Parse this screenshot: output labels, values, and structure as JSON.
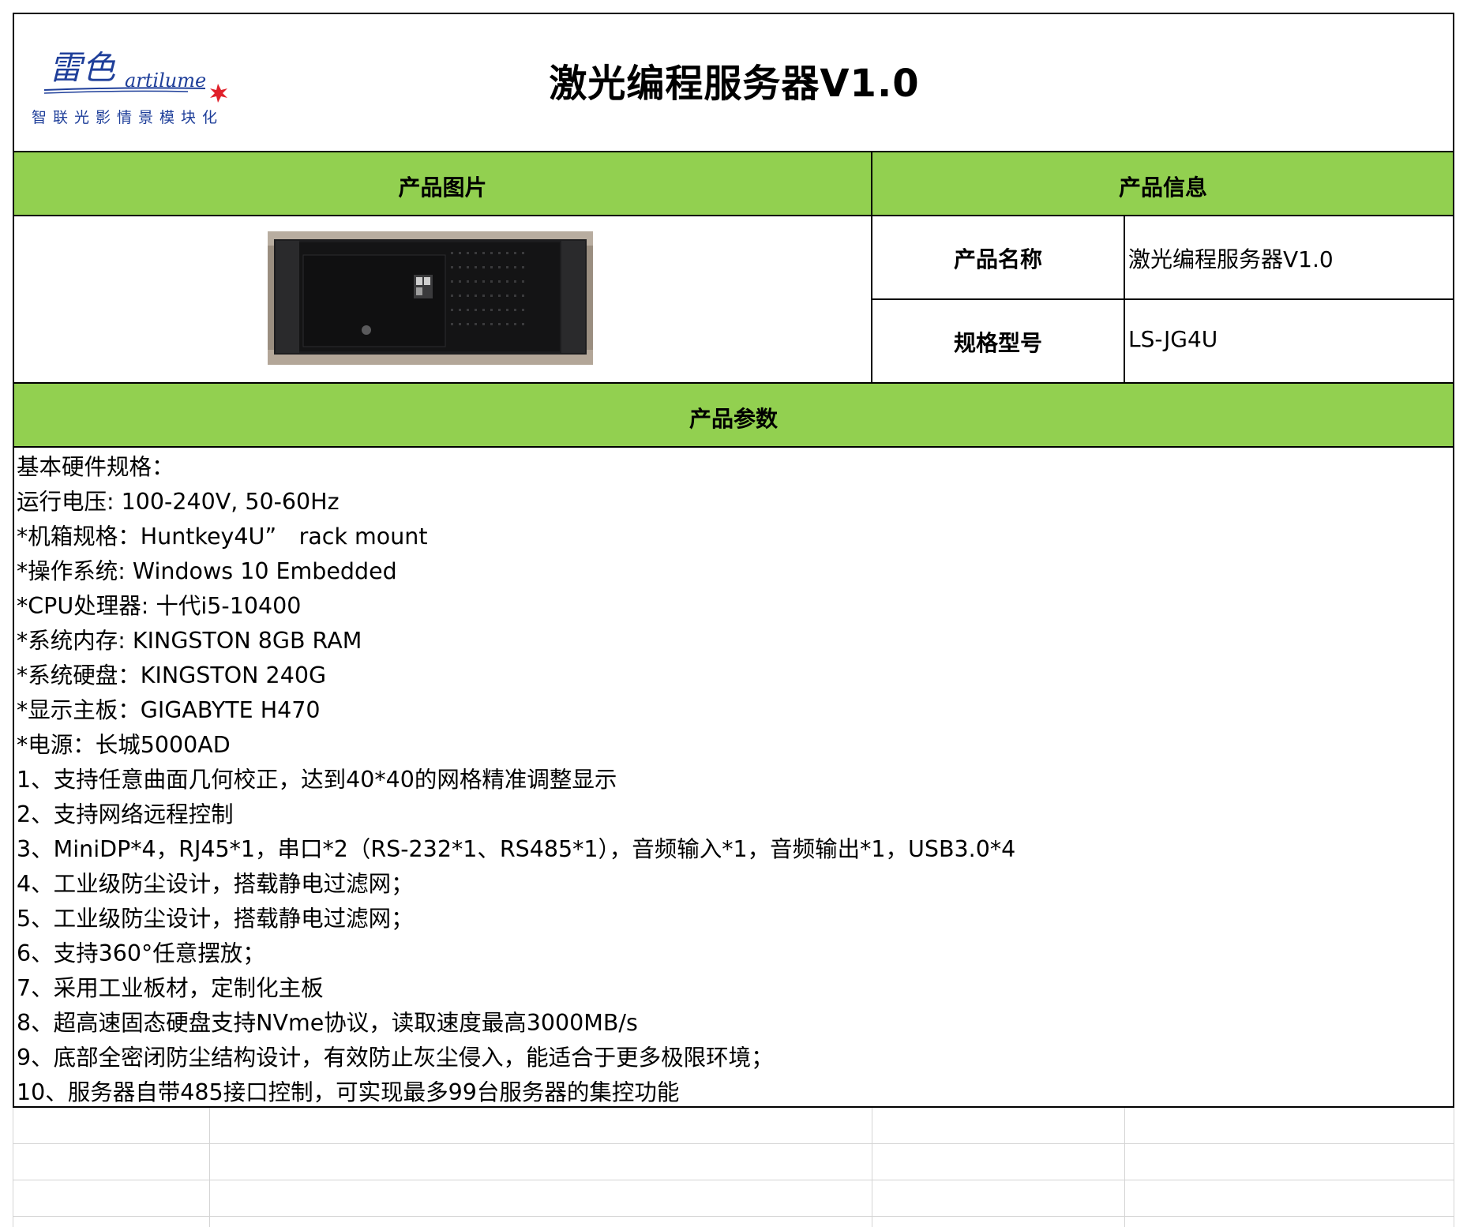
{
  "logo": {
    "cn_glyphs": "雷色",
    "en_name": "artilume",
    "tagline": "智联光影情景模块化"
  },
  "title": "激光编程服务器V1.0",
  "section_headers": {
    "image": "产品图片",
    "info": "产品信息",
    "params": "产品参数"
  },
  "info": {
    "name_label": "产品名称",
    "name_value": "激光编程服务器V1.0",
    "model_label": "规格型号",
    "model_value": "LS-JG4U"
  },
  "params": [
    "基本硬件规格：",
    "运行电压: 100-240V, 50-60Hz",
    "*机箱规格：Huntkey4U”　rack mount",
    "*操作系统: Windows 10 Embedded",
    "*CPU处理器: 十代i5-10400",
    "*系统内存: KINGSTON 8GB RAM",
    "*系统硬盘：KINGSTON 240G",
    "*显示主板：GIGABYTE H470",
    "*电源：长城5000AD",
    "1、支持任意曲面几何校正，达到40*40的网格精准调整显示",
    "2、支持网络远程控制",
    "3、MiniDP*4，RJ45*1，串口*2（RS-232*1、RS485*1），音频输入*1，音频输出*1，USB3.0*4",
    "4、工业级防尘设计，搭载静电过滤网；",
    "5、工业级防尘设计，搭载静电过滤网；",
    "6、支持360°任意摆放；",
    "7、采用工业板材，定制化主板",
    "8、超高速固态硬盘支持NVme协议，读取速度最高3000MB/s",
    "9、底部全密闭防尘结构设计，有效防止灰尘侵入，能适合于更多极限环境；",
    "10、服务器自带485接口控制，可实现最多99台服务器的集控功能"
  ],
  "colors": {
    "header_green": "#92d050",
    "logo_blue": "#1f3f9a",
    "logo_red": "#e0202a"
  }
}
